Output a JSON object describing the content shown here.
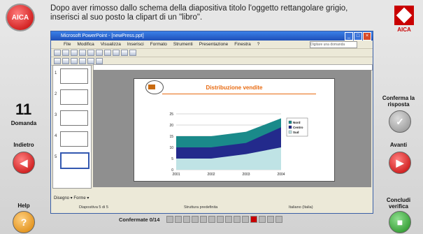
{
  "question": {
    "number": "11",
    "number_label": "Domanda",
    "text": "Dopo aver rimosso dallo schema della diapositiva titolo l'oggetto rettangolare grigio, inserisci al suo posto la clipart di un \"libro\"."
  },
  "brand": {
    "logo_text": "AICA",
    "quiz_logo_text": "AICA"
  },
  "nav": {
    "back": "Indietro",
    "forward": "Avanti",
    "help": "Help",
    "confirm": "Conferma la risposta",
    "finish": "Concludi verifica"
  },
  "app_window": {
    "title": "Microsoft PowerPoint - [newPress.ppt]",
    "menu": [
      "File",
      "Modifica",
      "Visualizza",
      "Inserisci",
      "Formato",
      "Strumenti",
      "Presentazione",
      "Finestra",
      "?"
    ],
    "help_placeholder": "Digitare una domanda",
    "thumbnails": [
      "1",
      "2",
      "3",
      "4",
      "5"
    ],
    "slide_title": "Distribuzione vendite",
    "drawing_toolbar": "Disegno ▾  Forme ▾",
    "status": [
      "Diapositiva 5 di 5",
      "Struttura predefinita",
      "Italiano (Italia)"
    ]
  },
  "chart_data": {
    "type": "area",
    "categories": [
      "2001",
      "2002",
      "2003",
      "2004"
    ],
    "series": [
      {
        "name": "Nord",
        "values": [
          15,
          15,
          17,
          23
        ]
      },
      {
        "name": "Centro",
        "values": [
          10,
          10,
          12,
          19
        ]
      },
      {
        "name": "Sud",
        "values": [
          5,
          5,
          7,
          10
        ]
      }
    ],
    "yticks": [
      "25",
      "20",
      "15",
      "10",
      "5",
      "0"
    ],
    "ylim": [
      0,
      25
    ],
    "legend_position": "right",
    "colors": [
      "#1a8a8a",
      "#232a8c",
      "#bfe3e5"
    ]
  },
  "progress": {
    "label": "Confermate",
    "value": "0/14",
    "total": 14,
    "current_index": 10
  }
}
